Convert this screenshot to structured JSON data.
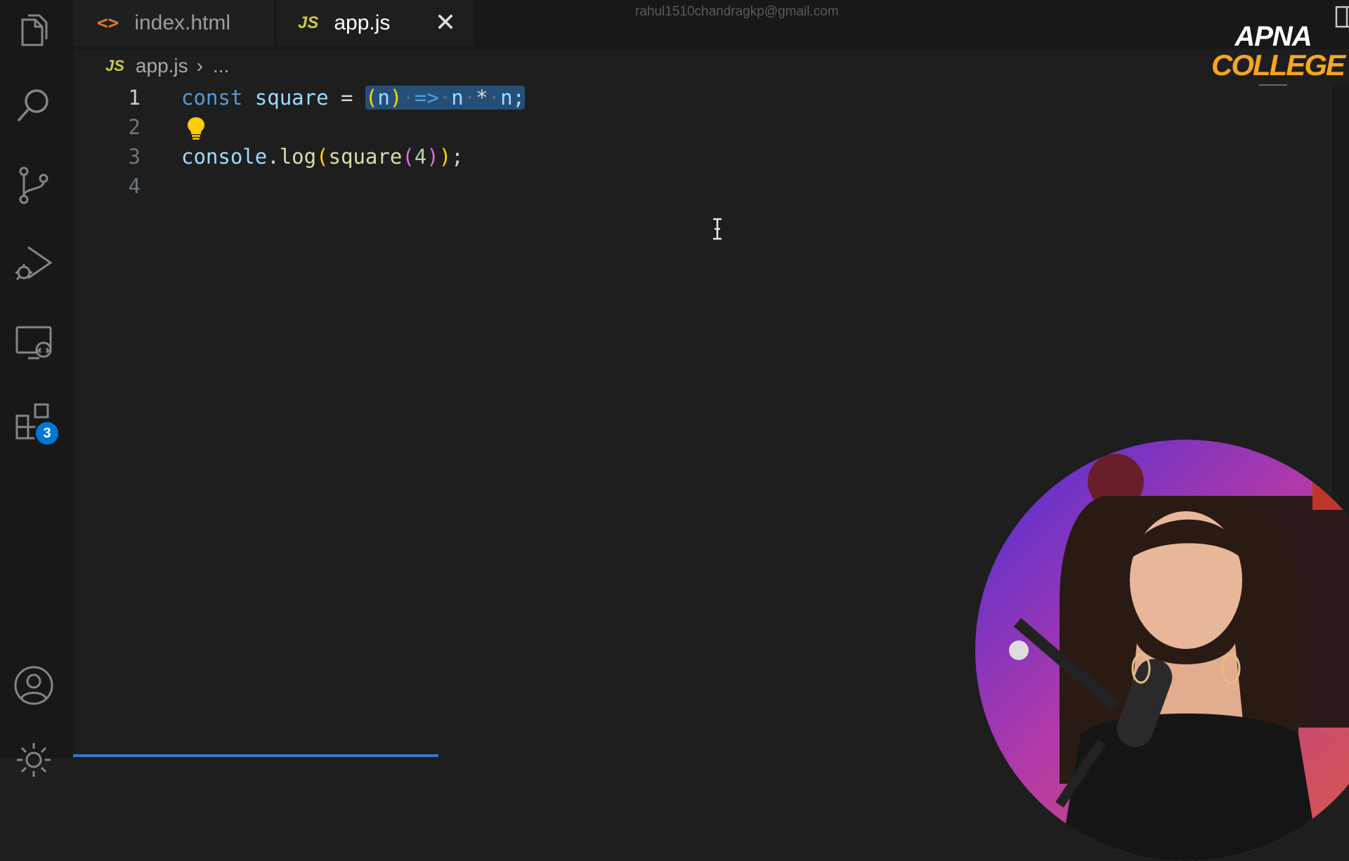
{
  "tabs": [
    {
      "icon_name": "html-file-icon",
      "icon_glyph": "<>",
      "label": "index.html",
      "active": false
    },
    {
      "icon_name": "js-file-icon",
      "icon_glyph": "JS",
      "label": "app.js",
      "active": true
    }
  ],
  "tab_close_glyph": "✕",
  "account_email": "rahul1510chandragkp@gmail.com",
  "more_actions_glyph": "···",
  "logo": {
    "line1": "APNA",
    "line2": "COLLEGE"
  },
  "breadcrumb": {
    "icon_glyph": "JS",
    "file": "app.js",
    "separator": "›",
    "rest": "..."
  },
  "editor": {
    "line_numbers": [
      "1",
      "2",
      "3",
      "4"
    ],
    "active_line": 1,
    "line1": {
      "kw": "const",
      "name": "square",
      "eq": "=",
      "sel_paren_open": "(",
      "sel_param": "n",
      "sel_paren_close": ")",
      "sel_arrow": "=>",
      "sel_n1": "n",
      "sel_mul": "*",
      "sel_n2": "n;"
    },
    "line3": {
      "obj": "console",
      "dot": ".",
      "method": "log",
      "p_open": "(",
      "fn": "square",
      "p2_open": "(",
      "arg": "4",
      "p2_close": ")",
      "p_close": ")",
      "semi": ";"
    }
  },
  "activity_bar": {
    "items": [
      "explorer-icon",
      "search-icon",
      "source-control-icon",
      "run-debug-icon",
      "remote-explorer-icon",
      "extensions-icon"
    ],
    "extensions_badge": "3",
    "bottom": [
      "account-icon",
      "settings-gear-icon"
    ]
  },
  "colors": {
    "background": "#1e1e1e",
    "selection": "#264f78",
    "keyword": "#569cd6",
    "variable": "#9cdcfe",
    "function": "#dcdcaa",
    "number": "#b5cea8",
    "badge": "#0078d4",
    "logo_accent": "#f5a623"
  }
}
